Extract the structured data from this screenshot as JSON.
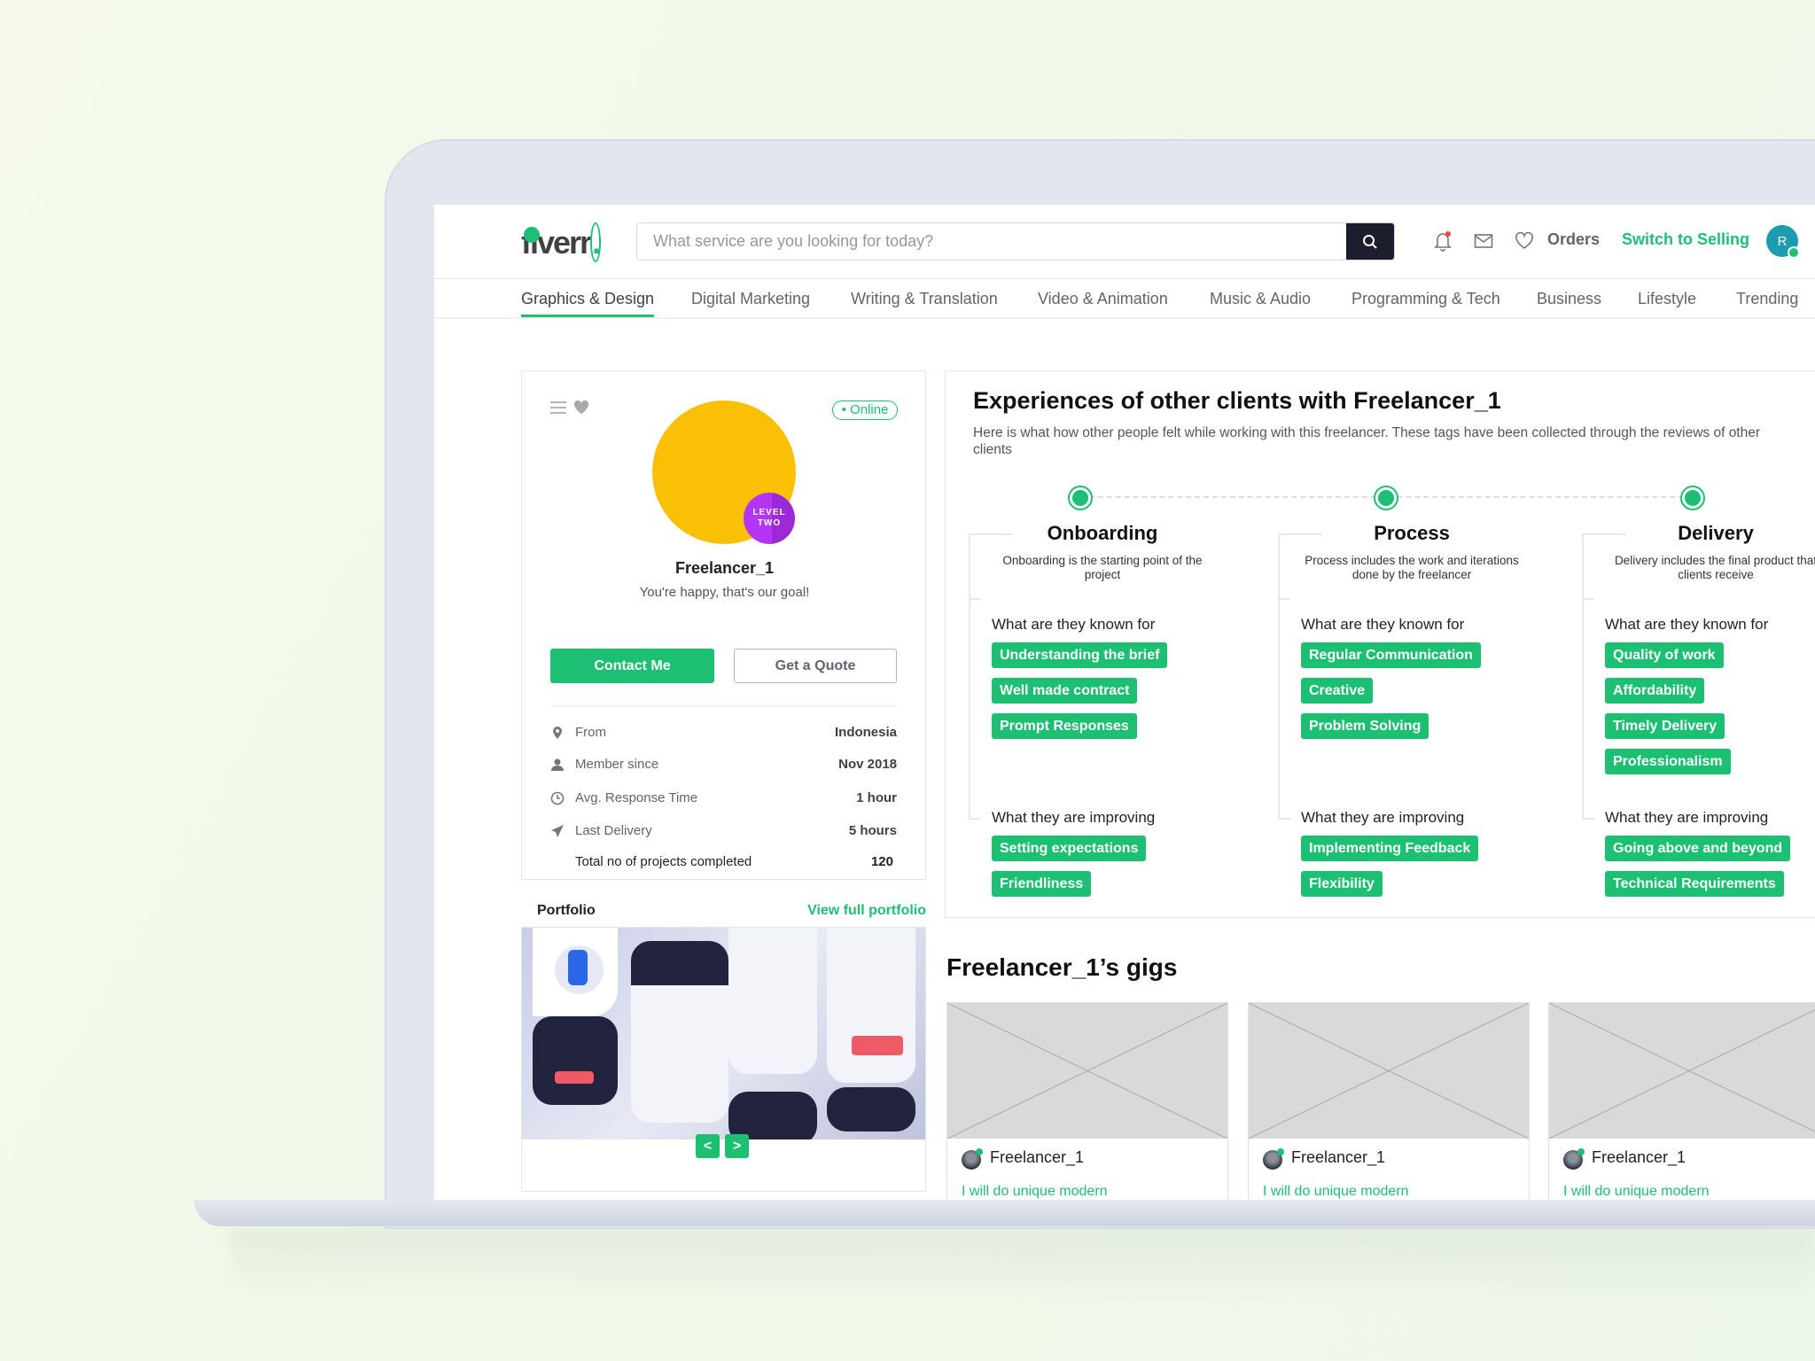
{
  "header": {
    "logo": "fiverr",
    "search_placeholder": "What service are you looking for today?",
    "orders": "Orders",
    "switch": "Switch to Selling",
    "avatar_initial": "R",
    "accent": "#1dbf73"
  },
  "nav": [
    "Graphics & Design",
    "Digital Marketing",
    "Writing & Translation",
    "Video & Animation",
    "Music & Audio",
    "Programming & Tech",
    "Business",
    "Lifestyle",
    "Trending"
  ],
  "profile": {
    "status": "Online",
    "level": [
      "LEVEL",
      "TWO"
    ],
    "name": "Freelancer_1",
    "tagline": "You're happy, that's our goal!",
    "contact": "Contact Me",
    "quote": "Get a Quote",
    "rows": [
      {
        "icon": "location-pin-icon",
        "label": "From",
        "value": "Indonesia"
      },
      {
        "icon": "user-icon",
        "label": "Member since",
        "value": "Nov 2018"
      },
      {
        "icon": "clock-icon",
        "label": "Avg. Response Time",
        "value": "1 hour"
      },
      {
        "icon": "send-icon",
        "label": "Last Delivery",
        "value": "5 hours"
      },
      {
        "label": "Total no of projects completed",
        "value": "120"
      }
    ]
  },
  "portfolio": {
    "title": "Portfolio",
    "view_all": "View full portfolio",
    "prev": "<",
    "next": ">"
  },
  "experiences": {
    "title": "Experiences of other clients with Freelancer_1",
    "subtitle": "Here is what how other people felt while working with this freelancer. These tags have been collected through the reviews of other clients",
    "known_label": "What are they known for",
    "improving_label": "What they are improving",
    "stages": [
      {
        "name": "Onboarding",
        "desc": "Onboarding is the starting point of the project",
        "known": [
          "Understanding the brief",
          "Well made contract",
          "Prompt Responses"
        ],
        "improving": [
          "Setting expectations",
          "Friendliness"
        ]
      },
      {
        "name": "Process",
        "desc": "Process includes the work and iterations done by the freelancer",
        "known": [
          "Regular Communication",
          "Creative",
          "Problem Solving"
        ],
        "improving": [
          "Implementing Feedback",
          "Flexibility"
        ]
      },
      {
        "name": "Delivery",
        "desc": "Delivery includes the final product that clients receive",
        "known": [
          "Quality of work",
          "Affordability",
          "Timely Delivery",
          "Professionalism"
        ],
        "improving": [
          "Going above and beyond",
          "Technical Requirements"
        ]
      }
    ]
  },
  "gigs": {
    "title": "Freelancer_1’s gigs",
    "items": [
      {
        "seller": "Freelancer_1",
        "title": "I will do unique modern"
      },
      {
        "seller": "Freelancer_1",
        "title": "I will do unique modern"
      },
      {
        "seller": "Freelancer_1",
        "title": "I will do unique modern"
      }
    ]
  }
}
